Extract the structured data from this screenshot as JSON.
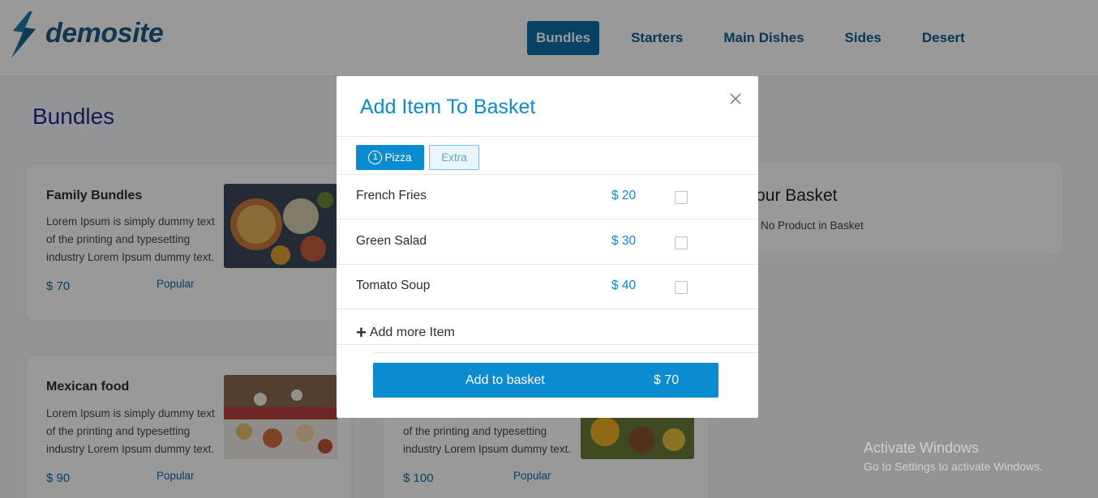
{
  "brand": {
    "name": "demosite"
  },
  "nav": {
    "items": [
      {
        "label": "Bundles",
        "active": true
      },
      {
        "label": "Starters",
        "active": false
      },
      {
        "label": "Main Dishes",
        "active": false
      },
      {
        "label": "Sides",
        "active": false
      },
      {
        "label": "Desert",
        "active": false
      }
    ]
  },
  "page": {
    "title": "Bundles"
  },
  "cards": [
    {
      "title": "Family Bundles",
      "desc": "Lorem Ipsum is simply dummy text of the printing and typesetting industry Lorem Ipsum dummy text.",
      "price": "$ 70",
      "tag": "Popular"
    },
    {
      "title": "Mexican food",
      "desc": "Lorem Ipsum is simply dummy text of the printing and typesetting industry Lorem Ipsum dummy text.",
      "price": "$ 90",
      "tag": "Popular"
    },
    {
      "title": "",
      "desc": "of the printing and typesetting industry Lorem Ipsum dummy text.",
      "price": "$ 100",
      "tag": "Popular"
    }
  ],
  "basket": {
    "title": "Your Basket",
    "subtitle": "No Product in Basket"
  },
  "watermark": {
    "line1": "Activate Windows",
    "line2": "Go to Settings to activate Windows."
  },
  "modal": {
    "title": "Add Item To Basket",
    "tabs": [
      {
        "num": "1",
        "label": "Pizza",
        "active": true
      },
      {
        "label": "Extra",
        "active": false
      }
    ],
    "items": [
      {
        "name": "French Fries",
        "price": "$ 20",
        "checked": false
      },
      {
        "name": "Green Salad",
        "price": "$ 30",
        "checked": false
      },
      {
        "name": "Tomato Soup",
        "price": "$ 40",
        "checked": false
      }
    ],
    "add_more_label": "Add more Item",
    "add_button": {
      "label": "Add to basket",
      "amount": "$ 70"
    }
  },
  "colors": {
    "accent": "#0b8bd0",
    "nav_active": "#0b6fa5",
    "title_blue": "#1e2a8f"
  }
}
